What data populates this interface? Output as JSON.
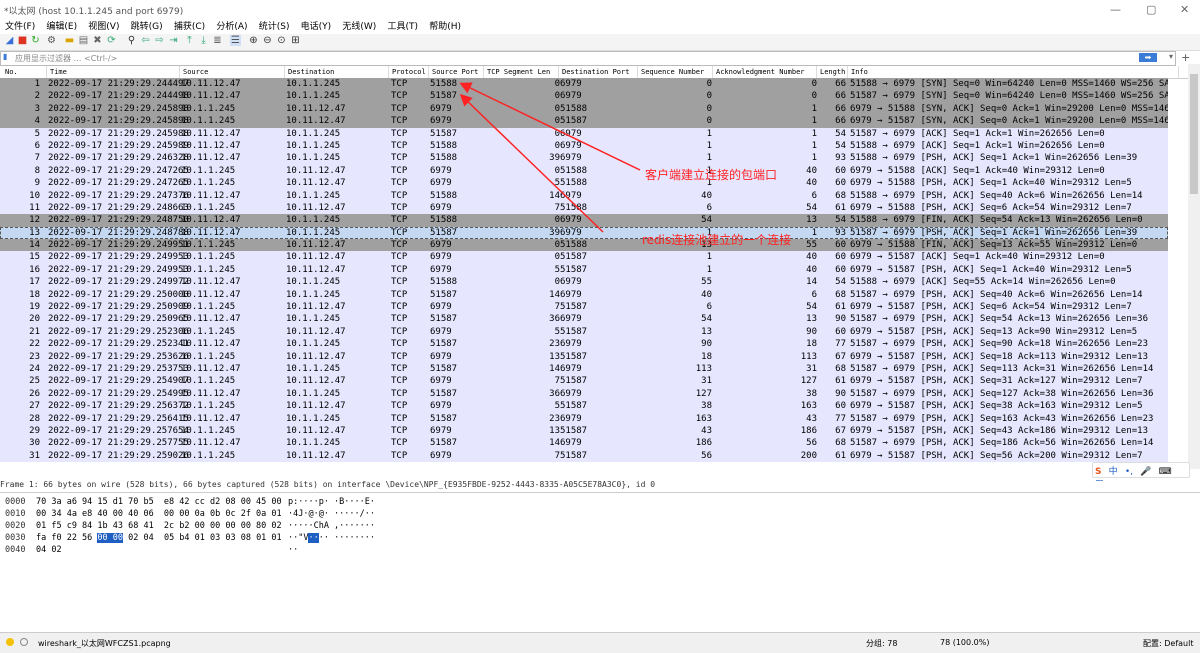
{
  "window": {
    "title": "*以太网 (host 10.1.1.245 and port 6979)",
    "controls": [
      "—",
      "▢",
      "✕"
    ]
  },
  "menu": [
    "文件(F)",
    "编辑(E)",
    "视图(V)",
    "跳转(G)",
    "捕获(C)",
    "分析(A)",
    "统计(S)",
    "电话(Y)",
    "无线(W)",
    "工具(T)",
    "帮助(H)"
  ],
  "filter": {
    "placeholder": "应用显示过滤器 … <Ctrl-/>",
    "apply_glyph": "➡",
    "plus": "+"
  },
  "columns": [
    "No.",
    "Time",
    "Source",
    "Destination",
    "Protocol",
    "Source Port",
    "TCP Segment Len",
    "Destination Port",
    "Sequence Number",
    "Acknowledgment Number",
    "Length",
    "Info"
  ],
  "packets": [
    {
      "no": "1",
      "time": "2022-09-17 21:29:29.244497",
      "src": "10.11.12.47",
      "dst": "10.1.1.245",
      "proto": "TCP",
      "sport": "51588",
      "seglen": "0",
      "dport": "6979",
      "seq": "0",
      "ack": "0",
      "len": "66",
      "info": "51588 → 6979 [SYN] Seq=0 Win=64240 Len=0 MSS=1460 WS=256 SACK_PE",
      "style": "dark"
    },
    {
      "no": "2",
      "time": "2022-09-17 21:29:29.244498",
      "src": "10.11.12.47",
      "dst": "10.1.1.245",
      "proto": "TCP",
      "sport": "51587",
      "seglen": "0",
      "dport": "6979",
      "seq": "0",
      "ack": "0",
      "len": "66",
      "info": "51587 → 6979 [SYN] Seq=0 Win=64240 Len=0 MSS=1460 WS=256 SACK_PE",
      "style": "dark"
    },
    {
      "no": "3",
      "time": "2022-09-17 21:29:29.245898",
      "src": "10.1.1.245",
      "dst": "10.11.12.47",
      "proto": "TCP",
      "sport": "6979",
      "seglen": "0",
      "dport": "51588",
      "seq": "0",
      "ack": "1",
      "len": "66",
      "info": "6979 → 51588 [SYN, ACK] Seq=0 Ack=1 Win=29200 Len=0 MSS=1460 SAC",
      "style": "dark"
    },
    {
      "no": "4",
      "time": "2022-09-17 21:29:29.245898",
      "src": "10.1.1.245",
      "dst": "10.11.12.47",
      "proto": "TCP",
      "sport": "6979",
      "seglen": "0",
      "dport": "51587",
      "seq": "0",
      "ack": "1",
      "len": "66",
      "info": "6979 → 51587 [SYN, ACK] Seq=0 Ack=1 Win=29200 Len=0 MSS=1460 SAC",
      "style": "dark"
    },
    {
      "no": "5",
      "time": "2022-09-17 21:29:29.245988",
      "src": "10.11.12.47",
      "dst": "10.1.1.245",
      "proto": "TCP",
      "sport": "51587",
      "seglen": "0",
      "dport": "6979",
      "seq": "1",
      "ack": "1",
      "len": "54",
      "info": "51587 → 6979 [ACK] Seq=1 Ack=1 Win=262656 Len=0",
      "style": "light"
    },
    {
      "no": "6",
      "time": "2022-09-17 21:29:29.245989",
      "src": "10.11.12.47",
      "dst": "10.1.1.245",
      "proto": "TCP",
      "sport": "51588",
      "seglen": "0",
      "dport": "6979",
      "seq": "1",
      "ack": "1",
      "len": "54",
      "info": "51588 → 6979 [ACK] Seq=1 Ack=1 Win=262656 Len=0",
      "style": "light"
    },
    {
      "no": "7",
      "time": "2022-09-17 21:29:29.246328",
      "src": "10.11.12.47",
      "dst": "10.1.1.245",
      "proto": "TCP",
      "sport": "51588",
      "seglen": "39",
      "dport": "6979",
      "seq": "1",
      "ack": "1",
      "len": "93",
      "info": "51588 → 6979 [PSH, ACK] Seq=1 Ack=1 Win=262656 Len=39",
      "style": "light"
    },
    {
      "no": "8",
      "time": "2022-09-17 21:29:29.247265",
      "src": "10.1.1.245",
      "dst": "10.11.12.47",
      "proto": "TCP",
      "sport": "6979",
      "seglen": "0",
      "dport": "51588",
      "seq": "1",
      "ack": "40",
      "len": "60",
      "info": "6979 → 51588 [ACK] Seq=1 Ack=40 Win=29312 Len=0",
      "style": "light"
    },
    {
      "no": "9",
      "time": "2022-09-17 21:29:29.247265",
      "src": "10.1.1.245",
      "dst": "10.11.12.47",
      "proto": "TCP",
      "sport": "6979",
      "seglen": "5",
      "dport": "51588",
      "seq": "1",
      "ack": "40",
      "len": "60",
      "info": "6979 → 51588 [PSH, ACK] Seq=1 Ack=40 Win=29312 Len=5",
      "style": "light"
    },
    {
      "no": "10",
      "time": "2022-09-17 21:29:29.247376",
      "src": "10.11.12.47",
      "dst": "10.1.1.245",
      "proto": "TCP",
      "sport": "51588",
      "seglen": "14",
      "dport": "6979",
      "seq": "40",
      "ack": "6",
      "len": "68",
      "info": "51588 → 6979 [PSH, ACK] Seq=40 Ack=6 Win=262656 Len=14",
      "style": "light"
    },
    {
      "no": "11",
      "time": "2022-09-17 21:29:29.248663",
      "src": "10.1.1.245",
      "dst": "10.11.12.47",
      "proto": "TCP",
      "sport": "6979",
      "seglen": "7",
      "dport": "51588",
      "seq": "6",
      "ack": "54",
      "len": "61",
      "info": "6979 → 51588 [PSH, ACK] Seq=6 Ack=54 Win=29312 Len=7",
      "style": "light"
    },
    {
      "no": "12",
      "time": "2022-09-17 21:29:29.248750",
      "src": "10.11.12.47",
      "dst": "10.1.1.245",
      "proto": "TCP",
      "sport": "51588",
      "seglen": "0",
      "dport": "6979",
      "seq": "54",
      "ack": "13",
      "len": "54",
      "info": "51588 → 6979 [FIN, ACK] Seq=54 Ack=13 Win=262656 Len=0",
      "style": "dark"
    },
    {
      "no": "13",
      "time": "2022-09-17 21:29:29.248788",
      "src": "10.11.12.47",
      "dst": "10.1.1.245",
      "proto": "TCP",
      "sport": "51587",
      "seglen": "39",
      "dport": "6979",
      "seq": "1",
      "ack": "1",
      "len": "93",
      "info": "51587 → 6979 [PSH, ACK] Seq=1 Ack=1 Win=262656 Len=39",
      "style": "sel"
    },
    {
      "no": "14",
      "time": "2022-09-17 21:29:29.249951",
      "src": "10.1.1.245",
      "dst": "10.11.12.47",
      "proto": "TCP",
      "sport": "6979",
      "seglen": "0",
      "dport": "51588",
      "seq": "13",
      "ack": "55",
      "len": "60",
      "info": "6979 → 51588 [FIN, ACK] Seq=13 Ack=55 Win=29312 Len=0",
      "style": "dark"
    },
    {
      "no": "15",
      "time": "2022-09-17 21:29:29.249953",
      "src": "10.1.1.245",
      "dst": "10.11.12.47",
      "proto": "TCP",
      "sport": "6979",
      "seglen": "0",
      "dport": "51587",
      "seq": "1",
      "ack": "40",
      "len": "60",
      "info": "6979 → 51587 [ACK] Seq=1 Ack=40 Win=29312 Len=0",
      "style": "light"
    },
    {
      "no": "16",
      "time": "2022-09-17 21:29:29.249953",
      "src": "10.1.1.245",
      "dst": "10.11.12.47",
      "proto": "TCP",
      "sport": "6979",
      "seglen": "5",
      "dport": "51587",
      "seq": "1",
      "ack": "40",
      "len": "60",
      "info": "6979 → 51587 [PSH, ACK] Seq=1 Ack=40 Win=29312 Len=5",
      "style": "light"
    },
    {
      "no": "17",
      "time": "2022-09-17 21:29:29.249972",
      "src": "10.11.12.47",
      "dst": "10.1.1.245",
      "proto": "TCP",
      "sport": "51588",
      "seglen": "0",
      "dport": "6979",
      "seq": "55",
      "ack": "14",
      "len": "54",
      "info": "51588 → 6979 [ACK] Seq=55 Ack=14 Win=262656 Len=0",
      "style": "light"
    },
    {
      "no": "18",
      "time": "2022-09-17 21:29:29.250000",
      "src": "10.11.12.47",
      "dst": "10.1.1.245",
      "proto": "TCP",
      "sport": "51587",
      "seglen": "14",
      "dport": "6979",
      "seq": "40",
      "ack": "6",
      "len": "68",
      "info": "51587 → 6979 [PSH, ACK] Seq=40 Ack=6 Win=262656 Len=14",
      "style": "light"
    },
    {
      "no": "19",
      "time": "2022-09-17 21:29:29.250909",
      "src": "10.1.1.245",
      "dst": "10.11.12.47",
      "proto": "TCP",
      "sport": "6979",
      "seglen": "7",
      "dport": "51587",
      "seq": "6",
      "ack": "54",
      "len": "61",
      "info": "6979 → 51587 [PSH, ACK] Seq=6 Ack=54 Win=29312 Len=7",
      "style": "light"
    },
    {
      "no": "20",
      "time": "2022-09-17 21:29:29.250965",
      "src": "10.11.12.47",
      "dst": "10.1.1.245",
      "proto": "TCP",
      "sport": "51587",
      "seglen": "36",
      "dport": "6979",
      "seq": "54",
      "ack": "13",
      "len": "90",
      "info": "51587 → 6979 [PSH, ACK] Seq=54 Ack=13 Win=262656 Len=36",
      "style": "light"
    },
    {
      "no": "21",
      "time": "2022-09-17 21:29:29.252306",
      "src": "10.1.1.245",
      "dst": "10.11.12.47",
      "proto": "TCP",
      "sport": "6979",
      "seglen": "5",
      "dport": "51587",
      "seq": "13",
      "ack": "90",
      "len": "60",
      "info": "6979 → 51587 [PSH, ACK] Seq=13 Ack=90 Win=29312 Len=5",
      "style": "light"
    },
    {
      "no": "22",
      "time": "2022-09-17 21:29:29.252341",
      "src": "10.11.12.47",
      "dst": "10.1.1.245",
      "proto": "TCP",
      "sport": "51587",
      "seglen": "23",
      "dport": "6979",
      "seq": "90",
      "ack": "18",
      "len": "77",
      "info": "51587 → 6979 [PSH, ACK] Seq=90 Ack=18 Win=262656 Len=23",
      "style": "light"
    },
    {
      "no": "23",
      "time": "2022-09-17 21:29:29.253626",
      "src": "10.1.1.245",
      "dst": "10.11.12.47",
      "proto": "TCP",
      "sport": "6979",
      "seglen": "13",
      "dport": "51587",
      "seq": "18",
      "ack": "113",
      "len": "67",
      "info": "6979 → 51587 [PSH, ACK] Seq=18 Ack=113 Win=29312 Len=13",
      "style": "light"
    },
    {
      "no": "24",
      "time": "2022-09-17 21:29:29.253753",
      "src": "10.11.12.47",
      "dst": "10.1.1.245",
      "proto": "TCP",
      "sport": "51587",
      "seglen": "14",
      "dport": "6979",
      "seq": "113",
      "ack": "31",
      "len": "68",
      "info": "51587 → 6979 [PSH, ACK] Seq=113 Ack=31 Win=262656 Len=14",
      "style": "light"
    },
    {
      "no": "25",
      "time": "2022-09-17 21:29:29.254907",
      "src": "10.1.1.245",
      "dst": "10.11.12.47",
      "proto": "TCP",
      "sport": "6979",
      "seglen": "7",
      "dport": "51587",
      "seq": "31",
      "ack": "127",
      "len": "61",
      "info": "6979 → 51587 [PSH, ACK] Seq=31 Ack=127 Win=29312 Len=7",
      "style": "light"
    },
    {
      "no": "26",
      "time": "2022-09-17 21:29:29.254995",
      "src": "10.11.12.47",
      "dst": "10.1.1.245",
      "proto": "TCP",
      "sport": "51587",
      "seglen": "36",
      "dport": "6979",
      "seq": "127",
      "ack": "38",
      "len": "90",
      "info": "51587 → 6979 [PSH, ACK] Seq=127 Ack=38 Win=262656 Len=36",
      "style": "light"
    },
    {
      "no": "27",
      "time": "2022-09-17 21:29:29.256372",
      "src": "10.1.1.245",
      "dst": "10.11.12.47",
      "proto": "TCP",
      "sport": "6979",
      "seglen": "5",
      "dport": "51587",
      "seq": "38",
      "ack": "163",
      "len": "60",
      "info": "6979 → 51587 [PSH, ACK] Seq=38 Ack=163 Win=29312 Len=5",
      "style": "light"
    },
    {
      "no": "28",
      "time": "2022-09-17 21:29:29.256415",
      "src": "10.11.12.47",
      "dst": "10.1.1.245",
      "proto": "TCP",
      "sport": "51587",
      "seglen": "23",
      "dport": "6979",
      "seq": "163",
      "ack": "43",
      "len": "77",
      "info": "51587 → 6979 [PSH, ACK] Seq=163 Ack=43 Win=262656 Len=23",
      "style": "light"
    },
    {
      "no": "29",
      "time": "2022-09-17 21:29:29.257654",
      "src": "10.1.1.245",
      "dst": "10.11.12.47",
      "proto": "TCP",
      "sport": "6979",
      "seglen": "13",
      "dport": "51587",
      "seq": "43",
      "ack": "186",
      "len": "67",
      "info": "6979 → 51587 [PSH, ACK] Seq=43 Ack=186 Win=29312 Len=13",
      "style": "light"
    },
    {
      "no": "30",
      "time": "2022-09-17 21:29:29.257755",
      "src": "10.11.12.47",
      "dst": "10.1.1.245",
      "proto": "TCP",
      "sport": "51587",
      "seglen": "14",
      "dport": "6979",
      "seq": "186",
      "ack": "56",
      "len": "68",
      "info": "51587 → 6979 [PSH, ACK] Seq=186 Ack=56 Win=262656 Len=14",
      "style": "light"
    },
    {
      "no": "31",
      "time": "2022-09-17 21:29:29.259026",
      "src": "10.1.1.245",
      "dst": "10.11.12.47",
      "proto": "TCP",
      "sport": "6979",
      "seglen": "7",
      "dport": "51587",
      "seq": "56",
      "ack": "200",
      "len": "61",
      "info": "6979 → 51587 [PSH, ACK] Seq=56 Ack=200 Win=29312 Len=7",
      "style": "light"
    }
  ],
  "detail_line": "Frame 1: 66 bytes on wire (528 bits), 66 bytes captured (528 bits) on interface \\Device\\NPF_{E935FBDE-9252-4443-8335-A05C5E78A3C0}, id 0",
  "hex_rows": [
    {
      "off": "0000",
      "pre": "70 3a a6 94 15 d1 70 b5  e8 42 cc d2 08 00 45 00",
      "hl": "",
      "post": "",
      "ascii_pre": "p:····p· ·B····E·",
      "ascii_hl": "",
      "ascii_post": ""
    },
    {
      "off": "0010",
      "pre": "00 34 4a e8 40 00 40 06  00 00 0a 0b 0c 2f 0a 01",
      "hl": "",
      "post": "",
      "ascii_pre": "·4J·@·@· ·····/··",
      "ascii_hl": "",
      "ascii_post": ""
    },
    {
      "off": "0020",
      "pre": "01 f5 c9 84 1b 43 68 41  2c b2 00 00 00 00 80 02",
      "hl": "",
      "post": "",
      "ascii_pre": "·····ChA ,·······",
      "ascii_hl": "",
      "ascii_post": ""
    },
    {
      "off": "0030",
      "pre": "fa f0 22 56 ",
      "hl": "00 00",
      "post": " 02 04  05 b4 01 03 03 08 01 01",
      "ascii_pre": "··\"V",
      "ascii_hl": "··",
      "ascii_post": "·· ········"
    },
    {
      "off": "0040",
      "pre": "04 02",
      "hl": "",
      "post": "",
      "ascii_pre": "··",
      "ascii_hl": "",
      "ascii_post": ""
    }
  ],
  "ime": [
    "S",
    "中",
    "•,",
    "🎤",
    "⌨",
    "▦"
  ],
  "status": {
    "file": "wireshark_以太网WFCZS1.pcapng",
    "groups": "分组: 78",
    "display": "78 (100.0%)",
    "profile": "配置: Default"
  },
  "annotations": {
    "client_ports": "客户端建立连接的包端口",
    "redis_conn": "redis连接池建立的一个连接"
  },
  "colors": {
    "row_light": "#e7e6ff",
    "row_dark": "#a0a0a0",
    "row_selected": "#c5d8f2",
    "annotation": "#ff2222",
    "hex_highlight": "#1f5fc4"
  }
}
